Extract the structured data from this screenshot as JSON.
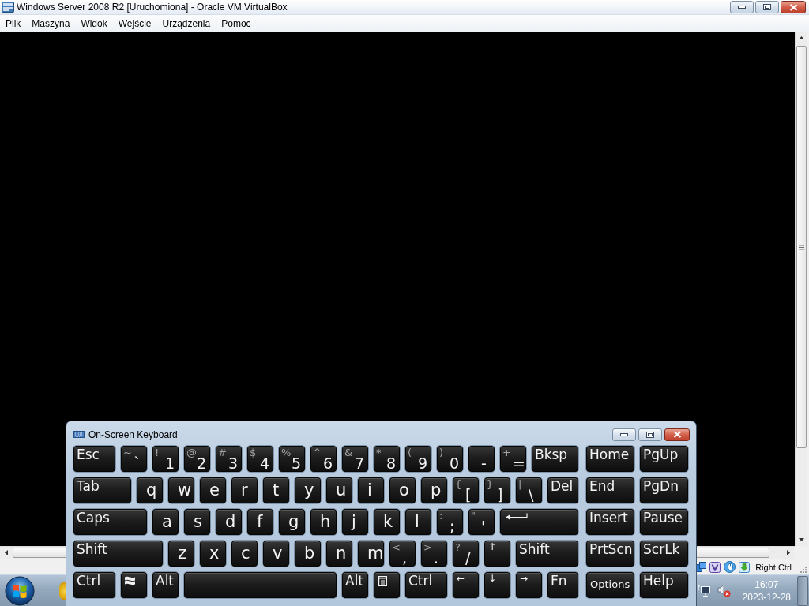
{
  "window": {
    "title": "Windows Server 2008 R2 [Uruchomiona] - Oracle VM VirtualBox"
  },
  "menu": [
    "Plik",
    "Maszyna",
    "Widok",
    "Wejście",
    "Urządzenia",
    "Pomoc"
  ],
  "status_bar": {
    "host_key": "Right Ctrl"
  },
  "keyboard": {
    "title": "On-Screen Keyboard",
    "main_rows": [
      [
        {
          "kind": "label",
          "main": "Esc"
        },
        {
          "kind": "symbol",
          "shift": "~",
          "main": "`"
        },
        {
          "kind": "symbol",
          "shift": "!",
          "main": "1"
        },
        {
          "kind": "symbol",
          "shift": "@",
          "main": "2"
        },
        {
          "kind": "symbol",
          "shift": "#",
          "main": "3"
        },
        {
          "kind": "symbol",
          "shift": "$",
          "main": "4"
        },
        {
          "kind": "symbol",
          "shift": "%",
          "main": "5"
        },
        {
          "kind": "symbol",
          "shift": "^",
          "main": "6"
        },
        {
          "kind": "symbol",
          "shift": "&",
          "main": "7"
        },
        {
          "kind": "symbol",
          "shift": "*",
          "main": "8"
        },
        {
          "kind": "symbol",
          "shift": "(",
          "main": "9"
        },
        {
          "kind": "symbol",
          "shift": ")",
          "main": "0"
        },
        {
          "kind": "symbol",
          "shift": "_",
          "main": "-"
        },
        {
          "kind": "symbol",
          "shift": "+",
          "main": "="
        },
        {
          "kind": "label",
          "main": "Bksp"
        }
      ],
      [
        {
          "kind": "label",
          "main": "Tab"
        },
        {
          "kind": "letter",
          "main": "q"
        },
        {
          "kind": "letter",
          "main": "w"
        },
        {
          "kind": "letter",
          "main": "e"
        },
        {
          "kind": "letter",
          "main": "r"
        },
        {
          "kind": "letter",
          "main": "t"
        },
        {
          "kind": "letter",
          "main": "y"
        },
        {
          "kind": "letter",
          "main": "u"
        },
        {
          "kind": "letter",
          "main": "i"
        },
        {
          "kind": "letter",
          "main": "o"
        },
        {
          "kind": "letter",
          "main": "p"
        },
        {
          "kind": "symbol",
          "shift": "{",
          "main": "["
        },
        {
          "kind": "symbol",
          "shift": "}",
          "main": "]"
        },
        {
          "kind": "symbol",
          "shift": "|",
          "main": "\\"
        },
        {
          "kind": "label",
          "main": "Del"
        }
      ],
      [
        {
          "kind": "label",
          "main": "Caps"
        },
        {
          "kind": "letter",
          "main": "a"
        },
        {
          "kind": "letter",
          "main": "s"
        },
        {
          "kind": "letter",
          "main": "d"
        },
        {
          "kind": "letter",
          "main": "f"
        },
        {
          "kind": "letter",
          "main": "g"
        },
        {
          "kind": "letter",
          "main": "h"
        },
        {
          "kind": "letter",
          "main": "j"
        },
        {
          "kind": "letter",
          "main": "k"
        },
        {
          "kind": "letter",
          "main": "l"
        },
        {
          "kind": "symbol",
          "shift": ":",
          "main": ";"
        },
        {
          "kind": "symbol",
          "shift": "\"",
          "main": "'"
        },
        {
          "kind": "enter"
        }
      ],
      [
        {
          "kind": "label",
          "main": "Shift"
        },
        {
          "kind": "letter",
          "main": "z"
        },
        {
          "kind": "letter",
          "main": "x"
        },
        {
          "kind": "letter",
          "main": "c"
        },
        {
          "kind": "letter",
          "main": "v"
        },
        {
          "kind": "letter",
          "main": "b"
        },
        {
          "kind": "letter",
          "main": "n"
        },
        {
          "kind": "letter",
          "main": "m"
        },
        {
          "kind": "symbol",
          "shift": "<",
          "main": ","
        },
        {
          "kind": "symbol",
          "shift": ">",
          "main": "."
        },
        {
          "kind": "symbol",
          "shift": "?",
          "main": "/"
        },
        {
          "kind": "arrow",
          "main": "↑"
        },
        {
          "kind": "label",
          "main": "Shift"
        }
      ],
      [
        {
          "kind": "label",
          "main": "Ctrl"
        },
        {
          "kind": "windows"
        },
        {
          "kind": "label",
          "main": "Alt"
        },
        {
          "kind": "space"
        },
        {
          "kind": "label",
          "main": "Alt"
        },
        {
          "kind": "menu"
        },
        {
          "kind": "label",
          "main": "Ctrl"
        },
        {
          "kind": "arrow",
          "main": "←"
        },
        {
          "kind": "arrow",
          "main": "↓"
        },
        {
          "kind": "arrow",
          "main": "→"
        },
        {
          "kind": "label",
          "main": "Fn"
        }
      ]
    ],
    "nav_rows": [
      [
        {
          "kind": "label",
          "main": "Home"
        },
        {
          "kind": "label",
          "main": "PgUp"
        }
      ],
      [
        {
          "kind": "label",
          "main": "End"
        },
        {
          "kind": "label",
          "main": "PgDn"
        }
      ],
      [
        {
          "kind": "label",
          "main": "Insert"
        },
        {
          "kind": "label",
          "main": "Pause"
        }
      ],
      [
        {
          "kind": "label",
          "main": "PrtScn"
        },
        {
          "kind": "label",
          "main": "ScrLk"
        }
      ],
      [
        {
          "kind": "option",
          "main": "Options"
        },
        {
          "kind": "label",
          "main": "Help"
        }
      ]
    ]
  },
  "taskbar": {
    "time": "16:07",
    "date": "2023-12-28"
  }
}
